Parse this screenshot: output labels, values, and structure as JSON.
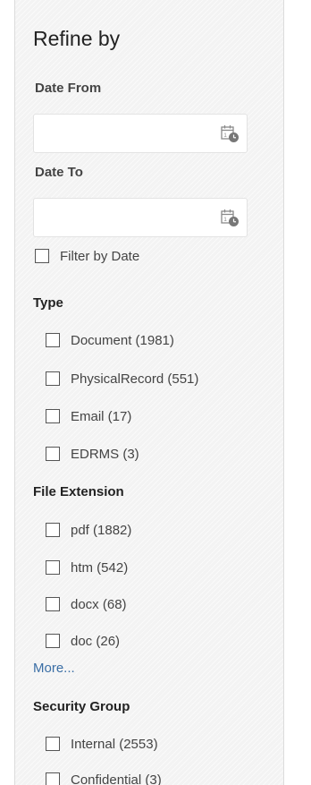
{
  "refine": {
    "title": "Refine by",
    "date_from_label": "Date From",
    "date_from_value": "",
    "date_to_label": "Date To",
    "date_to_value": "",
    "filter_by_date_label": "Filter by Date",
    "calendar_icon": "calendar-clock-icon"
  },
  "sections": {
    "type": {
      "heading": "Type",
      "items": [
        {
          "label": "Document (1981)",
          "checked": false
        },
        {
          "label": "PhysicalRecord (551)",
          "checked": false
        },
        {
          "label": "Email (17)",
          "checked": false
        },
        {
          "label": "EDRMS (3)",
          "checked": false
        }
      ]
    },
    "file_extension": {
      "heading": "File Extension",
      "items": [
        {
          "label": "pdf (1882)",
          "checked": false
        },
        {
          "label": "htm (542)",
          "checked": false
        },
        {
          "label": "docx (68)",
          "checked": false
        },
        {
          "label": "doc (26)",
          "checked": false
        }
      ],
      "more_label": "More..."
    },
    "security_group": {
      "heading": "Security Group",
      "items": [
        {
          "label": "Internal (2553)",
          "checked": false
        },
        {
          "label": "Confidential (3)",
          "checked": false
        }
      ]
    }
  },
  "colors": {
    "panel_background": "#f3f3f3",
    "link": "#3a6ea5",
    "text": "#444444"
  }
}
